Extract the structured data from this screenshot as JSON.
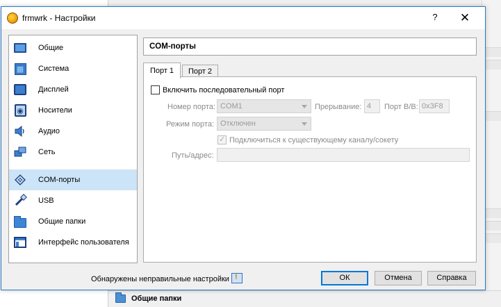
{
  "dialog": {
    "title": "frmwrk - Настройки",
    "help_label": "?",
    "close_label": "✕"
  },
  "sidebar": {
    "items": [
      {
        "label": "Общие",
        "icon": "monitor-icon"
      },
      {
        "label": "Система",
        "icon": "chip-icon"
      },
      {
        "label": "Дисплей",
        "icon": "display-icon"
      },
      {
        "label": "Носители",
        "icon": "storage-icon"
      },
      {
        "label": "Аудио",
        "icon": "speaker-icon"
      },
      {
        "label": "Сеть",
        "icon": "network-icon"
      },
      {
        "label": "COM-порты",
        "icon": "serial-port-icon"
      },
      {
        "label": "USB",
        "icon": "usb-icon"
      },
      {
        "label": "Общие папки",
        "icon": "folder-icon"
      },
      {
        "label": "Интерфейс пользователя",
        "icon": "window-ui-icon"
      }
    ],
    "selected_index": 6
  },
  "main": {
    "section_title": "COM-порты",
    "tabs": [
      {
        "label": "Порт 1",
        "active": true
      },
      {
        "label": "Порт 2",
        "active": false
      }
    ],
    "enable_port_label": "Включить последовательный порт",
    "enable_port_checked": false,
    "port_number_label": "Номер порта:",
    "port_number_value": "COM1",
    "irq_label": "Прерывание:",
    "irq_value": "4",
    "io_port_label": "Порт В/В:",
    "io_port_value": "0x3F8",
    "port_mode_label": "Режим порта:",
    "port_mode_value": "Отключен",
    "connect_existing_label": "Подключиться к существующему каналу/сокету",
    "connect_existing_checked": true,
    "path_label": "Путь/адрес:",
    "path_value": ""
  },
  "footer": {
    "warning_text": "Обнаружены неправильные настройки",
    "ok_label": "ОК",
    "cancel_label": "Отмена",
    "help_label": "Справка"
  },
  "background": {
    "section_label": "Общие папки"
  },
  "colors": {
    "selection": "#cce4f7",
    "accent": "#0078d7",
    "window_border": "#2b79c2"
  }
}
